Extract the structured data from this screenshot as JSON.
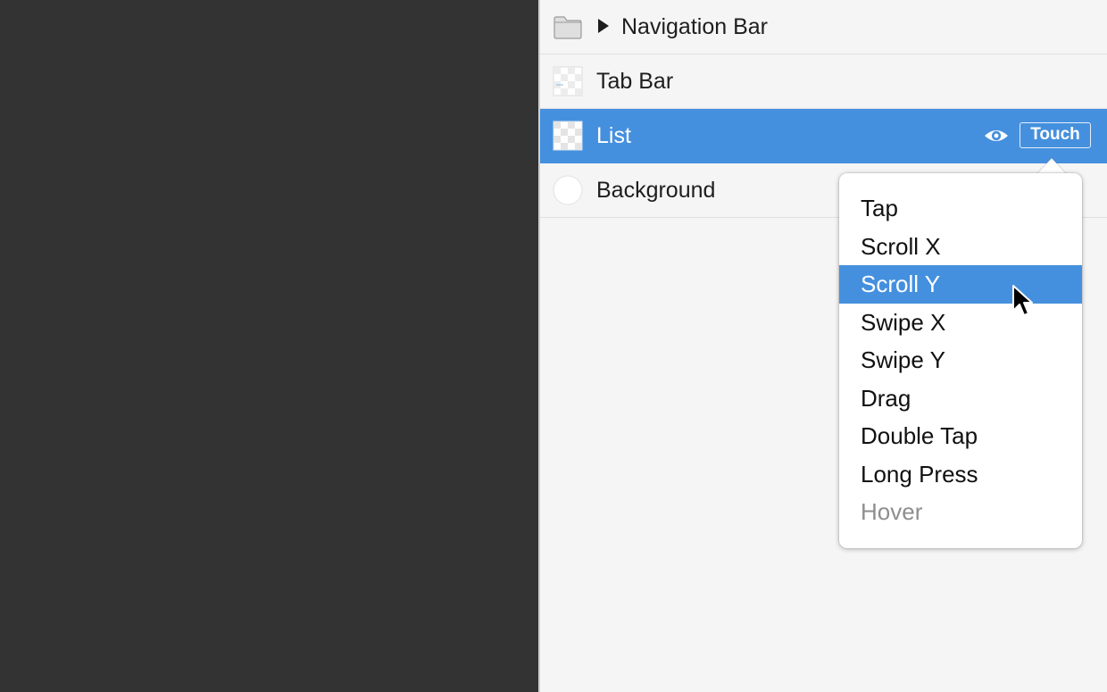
{
  "layers": [
    {
      "name": "Navigation Bar",
      "icon": "folder-icon",
      "collapsed": true,
      "selected": false
    },
    {
      "name": "Tab Bar",
      "icon": "layer-thumbnail-icon",
      "selected": false
    },
    {
      "name": "List",
      "icon": "layer-thumbnail-icon",
      "selected": true,
      "visible_icon": "eye-icon",
      "trigger_label": "Touch"
    },
    {
      "name": "Background",
      "icon": "color-circle-icon",
      "selected": false
    }
  ],
  "trigger_menu": {
    "items": [
      {
        "label": "Tap",
        "state": "normal"
      },
      {
        "label": "Scroll X",
        "state": "normal"
      },
      {
        "label": "Scroll Y",
        "state": "highlighted"
      },
      {
        "label": "Swipe X",
        "state": "normal"
      },
      {
        "label": "Swipe Y",
        "state": "normal"
      },
      {
        "label": "Drag",
        "state": "normal"
      },
      {
        "label": "Double Tap",
        "state": "normal"
      },
      {
        "label": "Long Press",
        "state": "normal"
      },
      {
        "label": "Hover",
        "state": "disabled"
      }
    ]
  },
  "colors": {
    "canvas_background": "#333333",
    "panel_background": "#f5f5f5",
    "selection": "#4590de",
    "disabled_text": "#8e8e8e"
  }
}
